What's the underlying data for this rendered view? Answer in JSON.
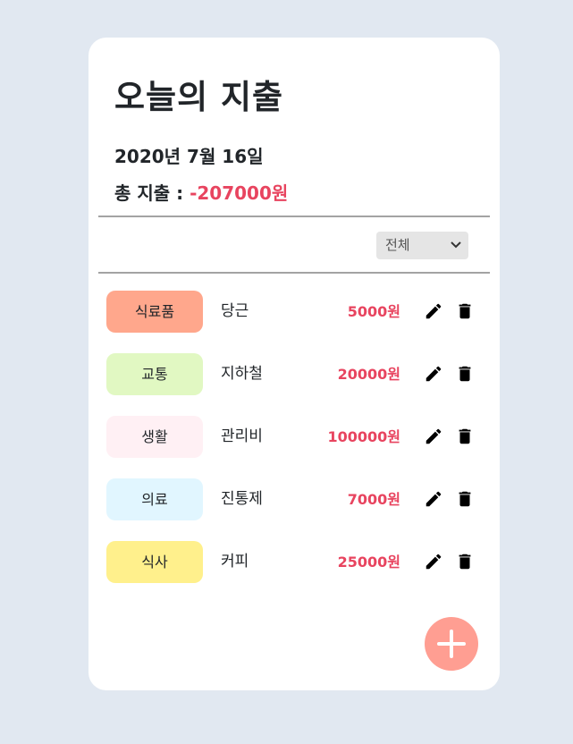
{
  "header": {
    "title": "오늘의 지출",
    "date": "2020년 7월 16일",
    "total_label": "총 지출 : ",
    "total_amount": "-207000원"
  },
  "filter": {
    "selected": "전체"
  },
  "expenses": [
    {
      "category": "식료품",
      "category_color": "#ffa78c",
      "name": "당근",
      "amount": "5000원"
    },
    {
      "category": "교통",
      "category_color": "#e1f8c2",
      "name": "지하철",
      "amount": "20000원"
    },
    {
      "category": "생활",
      "category_color": "#fff0f4",
      "name": "관리비",
      "amount": "100000원"
    },
    {
      "category": "의료",
      "category_color": "#e1f6ff",
      "name": "진통제",
      "amount": "7000원"
    },
    {
      "category": "식사",
      "category_color": "#fff08c",
      "name": "커피",
      "amount": "25000원"
    }
  ],
  "colors": {
    "accent": "#e8445f",
    "fab": "#ff9e92",
    "background": "#e1e8f1"
  },
  "icons": {
    "edit": "pencil-icon",
    "delete": "trash-icon",
    "add": "plus-icon",
    "dropdown": "chevron-down-icon"
  }
}
